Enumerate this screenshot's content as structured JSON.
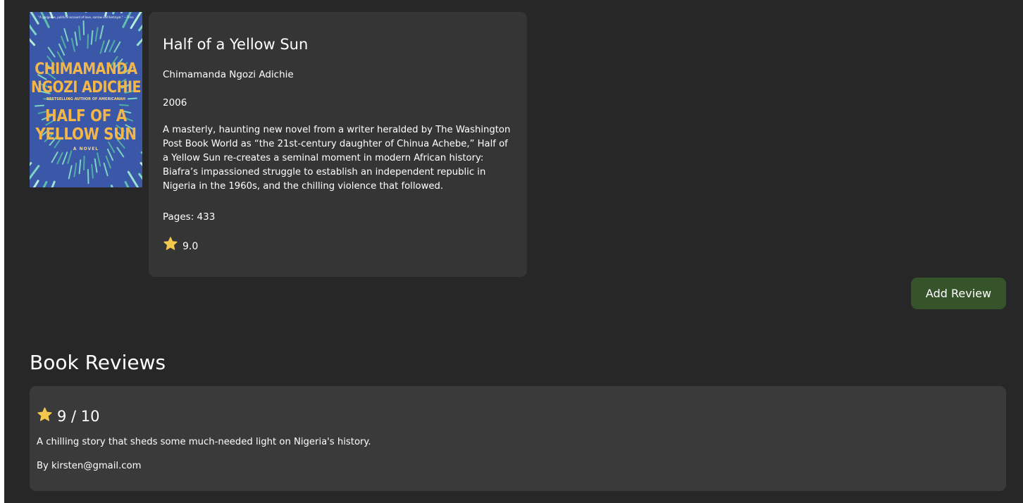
{
  "book": {
    "cover": {
      "tagline": "\"A gorgeous, political account of love, sorrow and betrayal.\" —Time",
      "author_line_1": "CHIMAMANDA",
      "author_line_2": "NGOZI ADICHIE",
      "bestseller_line": "BESTSELLING AUTHOR OF AMERICANAH",
      "title_line_1": "HALF OF A",
      "title_line_2": "YELLOW SUN",
      "novel_label": "A NOVEL",
      "background_color": "#3a57a8",
      "accent_color": "#f2b64a"
    },
    "title": "Half of a Yellow Sun",
    "author": "Chimamanda Ngozi Adichie",
    "year": "2006",
    "description": "A masterly, haunting new novel from a writer heralded by The Washington Post Book World as “the 21st-century daughter of Chinua Achebe,” Half of a Yellow Sun re-creates a seminal moment in modern African history: Biafra’s impassioned struggle to establish an independent republic in Nigeria in the 1960s, and the chilling violence that followed.",
    "pages": "Pages: 433",
    "rating_icon": "star-icon",
    "rating": "9.0"
  },
  "actions": {
    "add_review_label": "Add Review",
    "add_review_color": "#36542a"
  },
  "reviews": {
    "heading": "Book Reviews",
    "items": [
      {
        "score": "9 / 10",
        "body": "A chilling story that sheds some much-needed light on Nigeria's history.",
        "author": "By kirsten@gmail.com"
      }
    ]
  },
  "colors": {
    "page_background": "#272727",
    "card_background": "#353535",
    "review_background": "#3a3a3a",
    "star": "#f2c94c",
    "text": "#ffffff"
  }
}
